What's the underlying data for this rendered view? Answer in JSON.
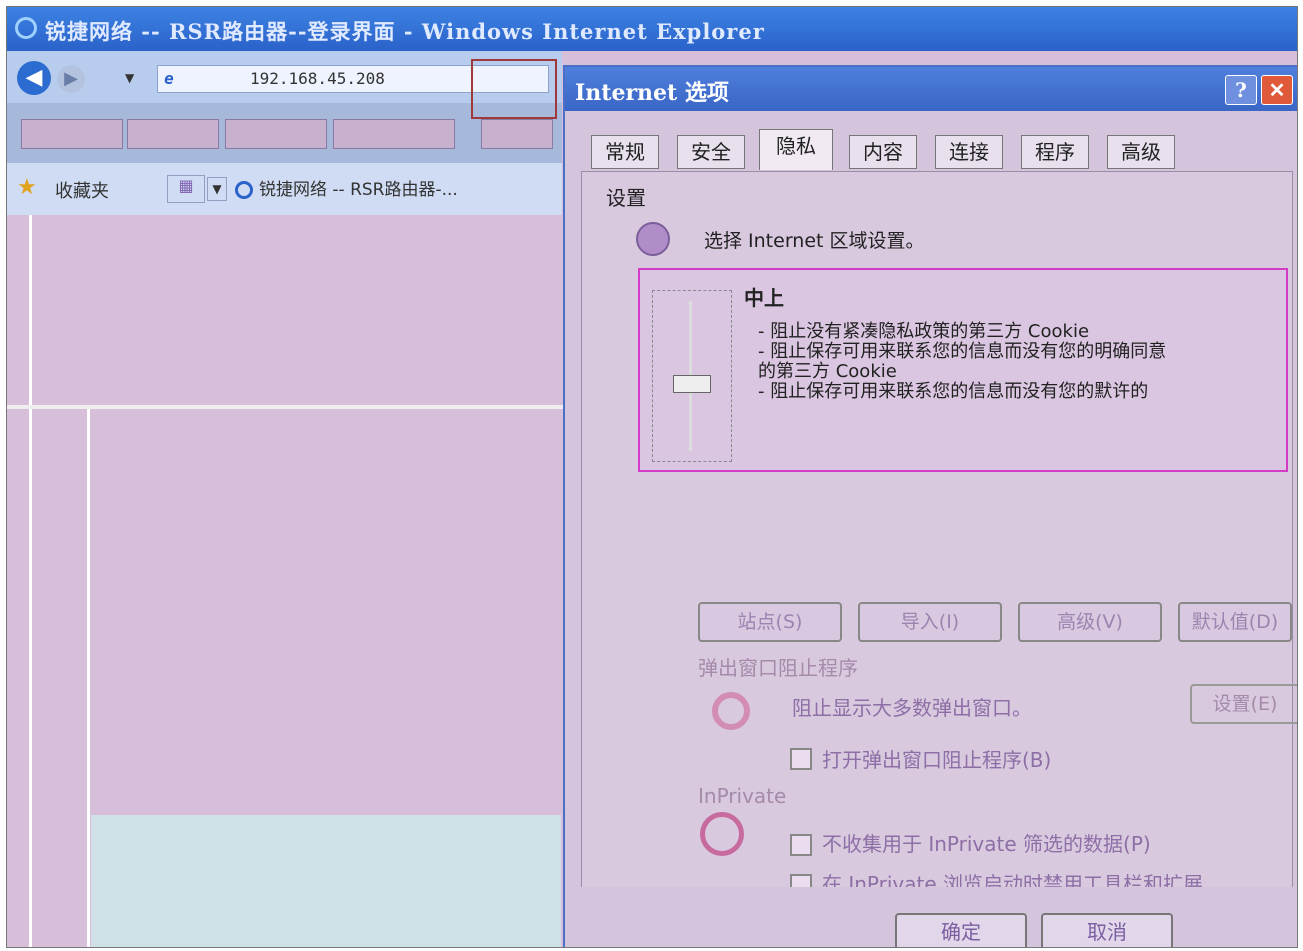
{
  "window": {
    "title": "锐捷网络 -- RSR路由器--登录界面 - Windows Internet Explorer"
  },
  "browser": {
    "address": "192.168.45.208",
    "favorites_label": "收藏夹",
    "favorite_tab": "锐捷网络 -- RSR路由器-..."
  },
  "dialog": {
    "title": "Internet 选项",
    "help_label": "?",
    "close_label": "✕",
    "tabs": [
      {
        "label": "常规"
      },
      {
        "label": "安全"
      },
      {
        "label": "隐私"
      },
      {
        "label": "内容"
      },
      {
        "label": "连接"
      },
      {
        "label": "程序"
      },
      {
        "label": "高级"
      }
    ],
    "active_tab": "隐私",
    "settings_group": "设置",
    "settings_desc": "选择 Internet 区域设置。",
    "privacy_level": "中上",
    "privacy_bullets": [
      "- 阻止没有紧凑隐私政策的第三方 Cookie",
      "- 阻止保存可用来联系您的信息而没有您的明确同意",
      "的第三方 Cookie",
      "- 阻止保存可用来联系您的信息而没有您的默许的"
    ],
    "buttons": {
      "sites": "站点(S)",
      "import": "导入(I)",
      "advanced": "高级(V)",
      "default": "默认值(D)"
    },
    "popup_group": "弹出窗口阻止程序",
    "popup_desc": "阻止显示大多数弹出窗口。",
    "popup_settings": "设置(E)",
    "popup_checkbox": "打开弹出窗口阻止程序(B)",
    "inprivate_group": "InPrivate",
    "inprivate_check1": "不收集用于 InPrivate 筛选的数据(P)",
    "inprivate_check2": "在 InPrivate 浏览启动时禁用工具栏和扩展",
    "ok": "确定",
    "cancel": "取消"
  },
  "colors": {
    "titlebar": "#2a62c9",
    "background": "#d7bfd9",
    "highlight_border": "#d23cc8"
  }
}
